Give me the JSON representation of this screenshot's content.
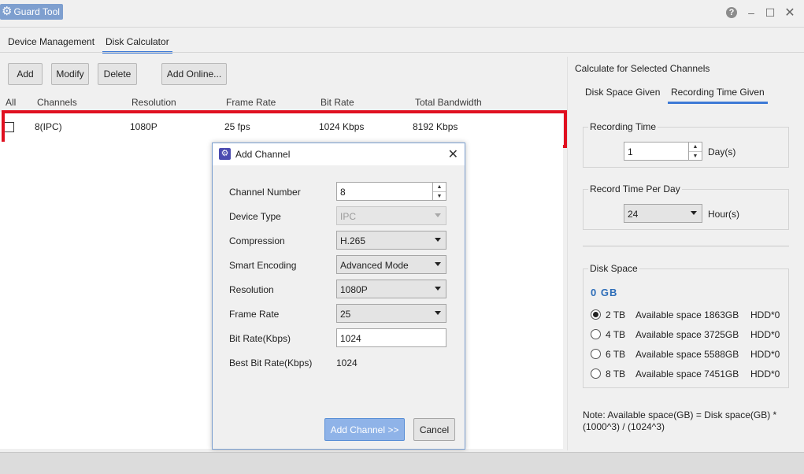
{
  "window": {
    "title": "Guard Tool",
    "controls": {
      "help": "?",
      "minimize": "–",
      "maximize": "☐",
      "close": "✕"
    }
  },
  "tabs": [
    {
      "label": "Device Management",
      "active": false
    },
    {
      "label": "Disk Calculator",
      "active": true
    }
  ],
  "toolbar": {
    "add": "Add",
    "modify": "Modify",
    "delete": "Delete",
    "add_online": "Add Online..."
  },
  "table": {
    "headers": [
      "All",
      "Channels",
      "Resolution",
      "Frame Rate",
      "Bit Rate",
      "Total Bandwidth"
    ],
    "rows": [
      {
        "channels": "8(IPC)",
        "resolution": "1080P",
        "frame_rate": "25 fps",
        "bit_rate": "1024 Kbps",
        "total_bandwidth": "8192 Kbps",
        "checked": false
      }
    ]
  },
  "right_panel": {
    "title": "Calculate for Selected Channels",
    "tabs": [
      {
        "label": "Disk Space Given",
        "active": false
      },
      {
        "label": "Recording Time Given",
        "active": true
      }
    ],
    "recording_time": {
      "label": "Recording Time",
      "value": "1",
      "unit": "Day(s)"
    },
    "record_time_per_day": {
      "label": "Record Time Per Day",
      "value": "24",
      "unit": "Hour(s)"
    },
    "disk_space": {
      "label": "Disk Space",
      "result": "0 GB",
      "options": [
        {
          "size": "2 TB",
          "available": "Available space 1863GB",
          "hdd": "HDD*0",
          "selected": true
        },
        {
          "size": "4 TB",
          "available": "Available space 3725GB",
          "hdd": "HDD*0",
          "selected": false
        },
        {
          "size": "6 TB",
          "available": "Available space 5588GB",
          "hdd": "HDD*0",
          "selected": false
        },
        {
          "size": "8 TB",
          "available": "Available space 7451GB",
          "hdd": "HDD*0",
          "selected": false
        }
      ]
    },
    "note": "Note: Available space(GB) = Disk space(GB) * (1000^3) / (1024^3)"
  },
  "dialog": {
    "title": "Add Channel",
    "fields": {
      "channel_number": {
        "label": "Channel Number",
        "value": "8"
      },
      "device_type": {
        "label": "Device Type",
        "value": "IPC"
      },
      "compression": {
        "label": "Compression",
        "value": "H.265"
      },
      "smart_encoding": {
        "label": "Smart Encoding",
        "value": "Advanced Mode"
      },
      "resolution": {
        "label": "Resolution",
        "value": "1080P"
      },
      "frame_rate": {
        "label": "Frame Rate",
        "value": "25"
      },
      "bit_rate": {
        "label": "Bit Rate(Kbps)",
        "value": "1024"
      },
      "best_bit_rate": {
        "label": "Best Bit Rate(Kbps)",
        "value": "1024"
      }
    },
    "add_button": "Add Channel >>",
    "cancel_button": "Cancel"
  },
  "colors": {
    "accent": "#3d7ad6",
    "highlight_border": "#e01020",
    "primary_button": "#8fb3e8",
    "disk_result": "#2d6db8"
  }
}
